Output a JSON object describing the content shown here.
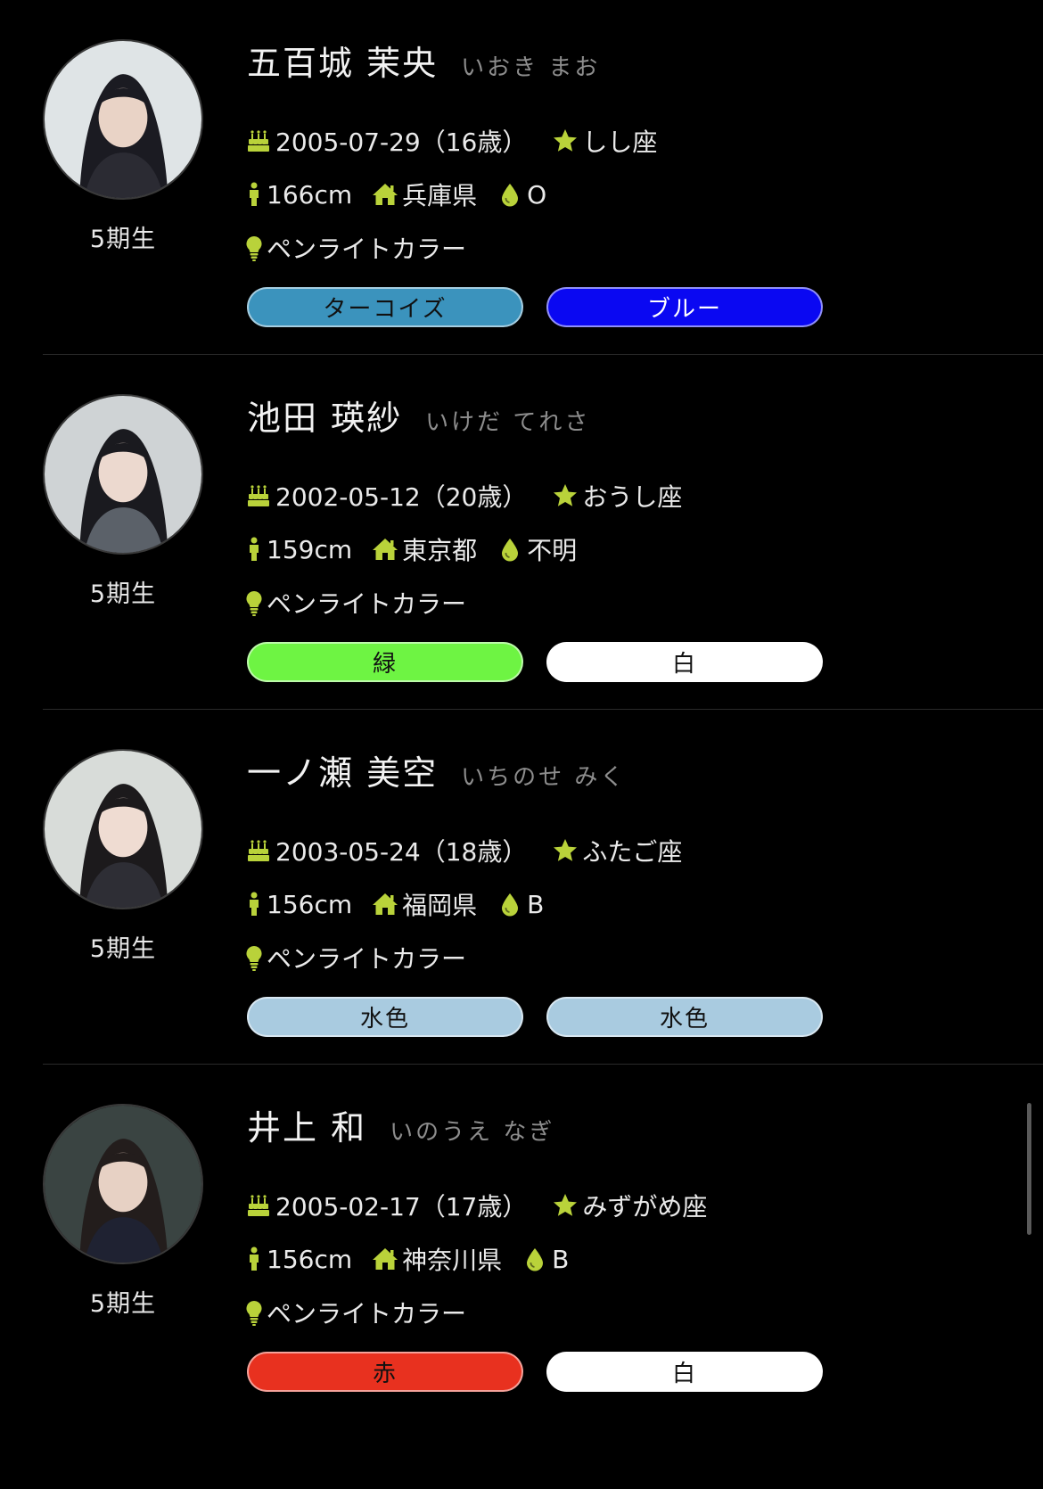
{
  "accent_color": "#b9d23a",
  "members": [
    {
      "name": "五百城 茉央",
      "kana": "いおき まお",
      "generation": "5期生",
      "birthday": "2005-07-29（16歳）",
      "zodiac": "しし座",
      "height": "166cm",
      "hometown": "兵庫県",
      "blood_type": "O",
      "penlight_label": "ペンライトカラー",
      "colors": [
        {
          "label": "ターコイズ",
          "bg": "#3b93bd",
          "fg": "#111111"
        },
        {
          "label": "ブルー",
          "bg": "#0a08f2",
          "fg": "#ffffff"
        }
      ]
    },
    {
      "name": "池田 瑛紗",
      "kana": "いけだ てれさ",
      "generation": "5期生",
      "birthday": "2002-05-12（20歳）",
      "zodiac": "おうし座",
      "height": "159cm",
      "hometown": "東京都",
      "blood_type": "不明",
      "penlight_label": "ペンライトカラー",
      "colors": [
        {
          "label": "緑",
          "bg": "#6ef443",
          "fg": "#111111"
        },
        {
          "label": "白",
          "bg": "#ffffff",
          "fg": "#111111"
        }
      ]
    },
    {
      "name": "一ノ瀬 美空",
      "kana": "いちのせ みく",
      "generation": "5期生",
      "birthday": "2003-05-24（18歳）",
      "zodiac": "ふたご座",
      "height": "156cm",
      "hometown": "福岡県",
      "blood_type": "B",
      "penlight_label": "ペンライトカラー",
      "colors": [
        {
          "label": "水色",
          "bg": "#a9cbe0",
          "fg": "#111111"
        },
        {
          "label": "水色",
          "bg": "#a9cbe0",
          "fg": "#111111"
        }
      ]
    },
    {
      "name": "井上 和",
      "kana": "いのうえ なぎ",
      "generation": "5期生",
      "birthday": "2005-02-17（17歳）",
      "zodiac": "みずがめ座",
      "height": "156cm",
      "hometown": "神奈川県",
      "blood_type": "B",
      "penlight_label": "ペンライトカラー",
      "colors": [
        {
          "label": "赤",
          "bg": "#e8311f",
          "fg": "#111111"
        },
        {
          "label": "白",
          "bg": "#ffffff",
          "fg": "#111111"
        }
      ]
    }
  ],
  "icons": {
    "birthday": "cake-icon",
    "zodiac": "star-icon",
    "height": "person-icon",
    "hometown": "home-icon",
    "blood_type": "drop-icon",
    "penlight": "bulb-icon"
  }
}
